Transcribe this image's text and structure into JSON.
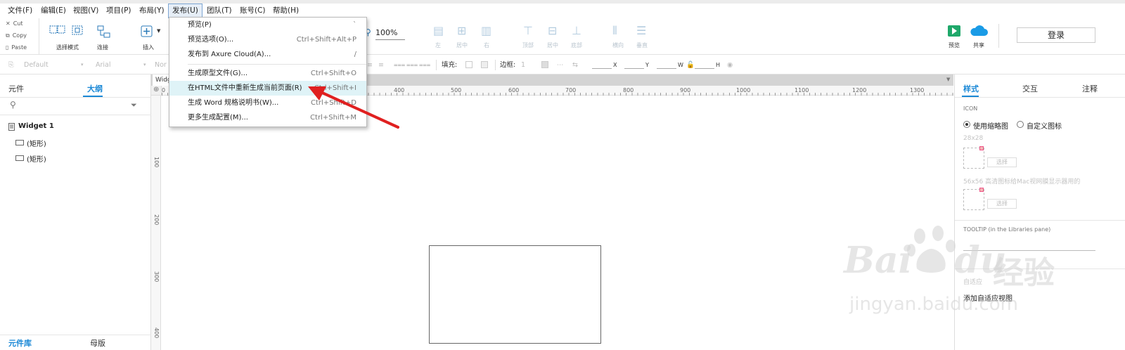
{
  "menubar": {
    "items": [
      "文件(F)",
      "编辑(E)",
      "视图(V)",
      "项目(P)",
      "布局(Y)",
      "发布(U)",
      "团队(T)",
      "账号(C)",
      "帮助(H)"
    ]
  },
  "clipboard": {
    "cut": "Cut",
    "copy": "Copy",
    "paste": "Paste"
  },
  "toolbar": {
    "select_mode": "选择模式",
    "connect": "连接",
    "insert": "插入",
    "zoom": "100%",
    "align": [
      "左",
      "居中",
      "右",
      "顶部",
      "居中",
      "底部"
    ],
    "distribute": [
      "横向",
      "垂直"
    ],
    "preview": "预览",
    "share": "共享",
    "login": "登录"
  },
  "formatbar": {
    "style": "Default",
    "font": "Arial",
    "weight": "Nor",
    "fill": "填充:",
    "border": "边框:",
    "border_value": "1",
    "x": "X",
    "y": "Y",
    "w": "W",
    "h": "H"
  },
  "publish_menu": {
    "items": [
      {
        "label": "预览(P)",
        "shortcut": "`"
      },
      {
        "label": "预览选项(O)...",
        "shortcut": "Ctrl+Shift+Alt+P"
      },
      {
        "label": "发布到 Axure Cloud(A)...",
        "shortcut": "/"
      },
      {
        "label": "生成原型文件(G)...",
        "shortcut": "Ctrl+Shift+O"
      },
      {
        "label": "在HTML文件中重新生成当前页面(R)",
        "shortcut": "Ctrl+Shift+I"
      },
      {
        "label": "生成 Word 规格说明书(W)...",
        "shortcut": "Ctrl+Shift+D"
      },
      {
        "label": "更多生成配置(M)...",
        "shortcut": "Ctrl+Shift+M"
      }
    ]
  },
  "left_panel": {
    "tabs": [
      "元件",
      "大纲"
    ],
    "active_tab": "大纲",
    "tree": {
      "root": "Widget 1",
      "children": [
        "(矩形)",
        "(矩形)"
      ]
    },
    "bottom_tabs": [
      "元件库",
      "母版"
    ]
  },
  "canvas": {
    "tab_label": "Widg",
    "ruler_top": [
      "0",
      "400",
      "500",
      "600",
      "700",
      "800",
      "900",
      "1000",
      "1100",
      "1200",
      "1300"
    ],
    "ruler_left": [
      "100",
      "200",
      "300",
      "400"
    ]
  },
  "right_panel": {
    "tabs": [
      "样式",
      "交互",
      "注释"
    ],
    "active_tab": "样式",
    "icon_heading": "ICON",
    "radio_thumbnail": "使用缩略图",
    "radio_custom": "自定义图标",
    "size_28": "28x28",
    "select_label": "选择",
    "size_56": "56x56 高清图标给Mac视网膜显示器用的",
    "tooltip_heading": "TOOLTIP (in the Libraries pane)",
    "adaptive_label": "自适应",
    "add_adaptive": "添加自适应视图"
  },
  "watermark": {
    "logo": "Bai",
    "logo2": "du",
    "cn": "经验",
    "url": "jingyan.baidu.com"
  },
  "colors": {
    "accent": "#1a88d6",
    "arrow": "#e02020",
    "highlight": "#dff3f7"
  }
}
